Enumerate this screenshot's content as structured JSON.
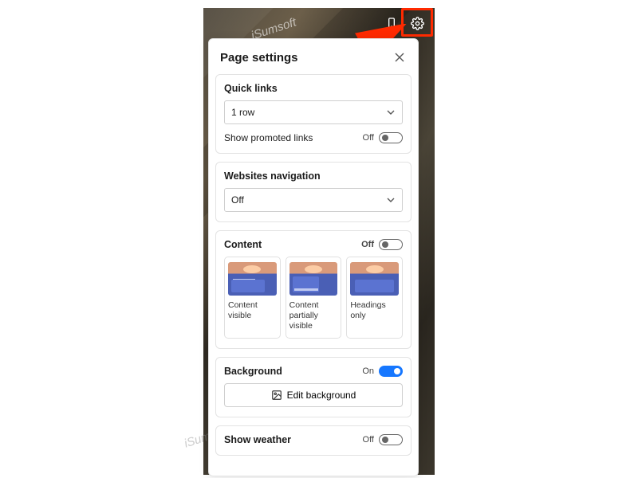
{
  "watermark": "iSumsoft",
  "header": {
    "title": "Page settings"
  },
  "toggle_labels": {
    "on": "On",
    "off": "Off"
  },
  "sections": {
    "quick_links": {
      "title": "Quick links",
      "select_value": "1 row",
      "promoted_label": "Show promoted links",
      "promoted_state": "Off"
    },
    "websites_nav": {
      "title": "Websites navigation",
      "select_value": "Off"
    },
    "content": {
      "title": "Content",
      "state": "Off",
      "tiles": [
        {
          "caption": "Content visible"
        },
        {
          "caption": "Content partially visible"
        },
        {
          "caption": "Headings only"
        }
      ]
    },
    "background": {
      "title": "Background",
      "state": "On",
      "edit_label": "Edit background"
    },
    "weather": {
      "title": "Show weather",
      "state": "Off"
    }
  }
}
